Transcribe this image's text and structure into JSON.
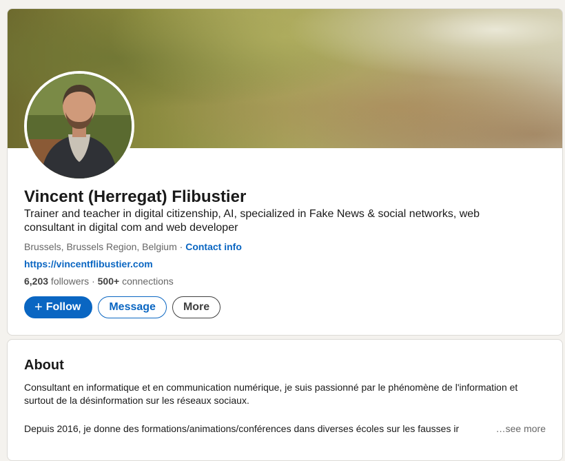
{
  "profile": {
    "name": "Vincent (Herregat) Flibustier",
    "headline": "Trainer and teacher in digital citizenship, AI, specialized in Fake News & social networks, web consultant in digital com and web developer",
    "location": "Brussels, Brussels Region, Belgium",
    "location_separator": " · ",
    "contact_info": "Contact info",
    "website": "https://vincentflibustier.com",
    "followers_count": "6,203",
    "followers_label": " followers",
    "connections_separator": " · ",
    "connections_count": "500+",
    "connections_label": " connections"
  },
  "actions": {
    "follow_icon": "+",
    "follow_label": "Follow",
    "message_label": "Message",
    "more_label": "More"
  },
  "about": {
    "title": "About",
    "paragraph1": "Consultant en informatique et en communication numérique, je suis passionné par le phénomène de l'information et surtout de la désinformation sur les réseaux sociaux.",
    "paragraph2": "Depuis 2016, je donne des formations/animations/conférences dans diverses écoles sur les fausses ir",
    "see_more": "…see more"
  },
  "colors": {
    "accent": "#0a66c2",
    "background": "#f4f2ee",
    "card": "#ffffff",
    "text_secondary": "#666666"
  },
  "icons": {
    "follow": "plus-icon"
  }
}
